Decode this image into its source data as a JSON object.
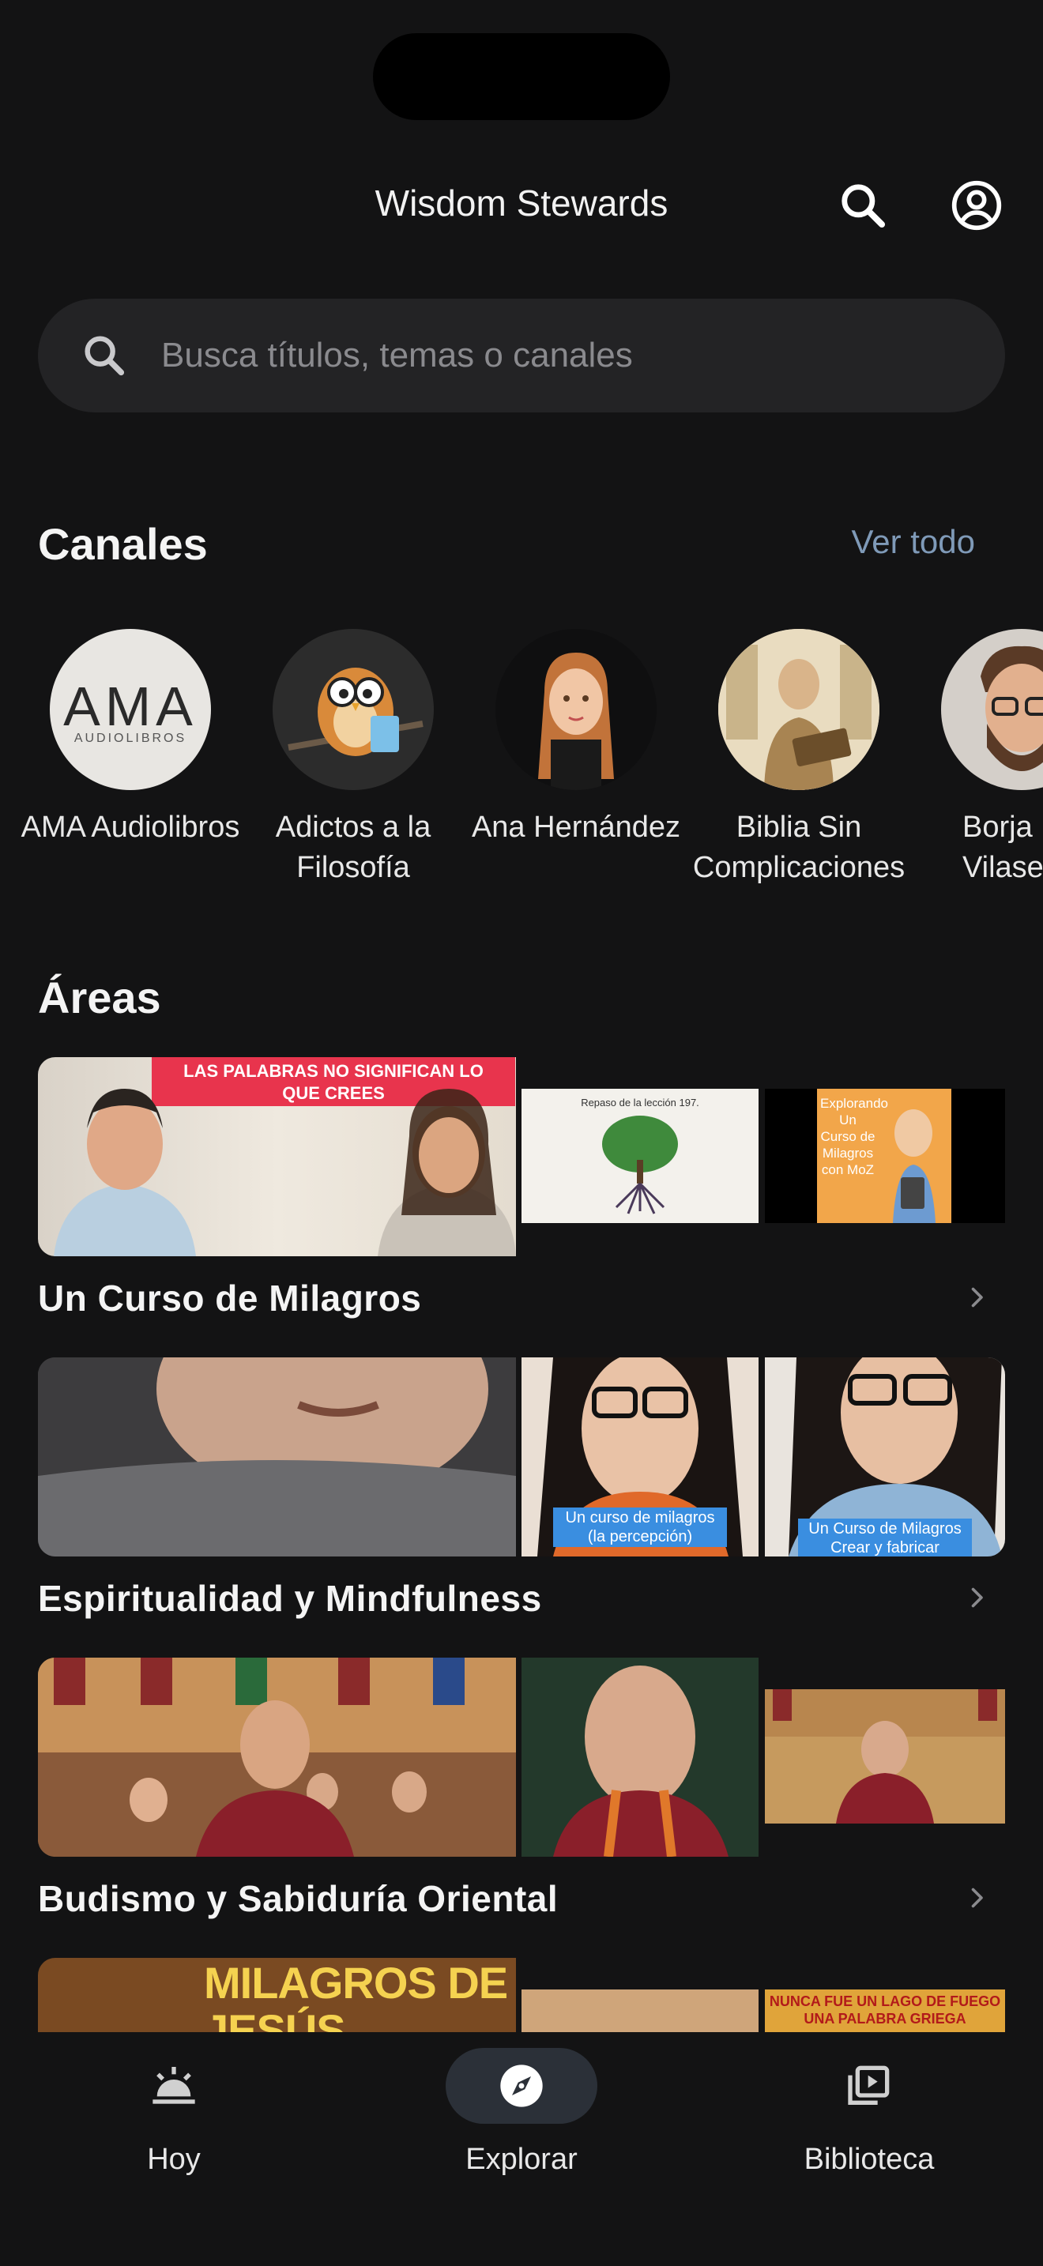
{
  "header": {
    "title": "Wisdom Stewards"
  },
  "search": {
    "placeholder": "Busca títulos, temas o canales"
  },
  "channels_section": {
    "title": "Canales",
    "see_all": "Ver todo",
    "items": [
      {
        "name": "AMA Audiolibros",
        "logo_main": "AMA",
        "logo_sub": "AUDIOLIBROS"
      },
      {
        "name": "Adictos a la Filosofía"
      },
      {
        "name": "Ana Hernández"
      },
      {
        "name": "Biblia Sin Complicaciones"
      },
      {
        "name": "Borja Vilaseca"
      }
    ]
  },
  "areas_section": {
    "title": "Áreas",
    "items": [
      {
        "label": "Un Curso de Milagros",
        "thumb1_banner": "LAS PALABRAS NO SIGNIFICAN LO QUE CREES",
        "thumb2_text": "Repaso de la lección 197.",
        "thumb3_text": "Explorando Un Curso de Milagros con MoZ"
      },
      {
        "label": "Espiritualidad y Mindfulness",
        "thumb2_caption": "Un curso de milagros (la percepción)",
        "thumb3_caption": "Un Curso de Milagros Crear y fabricar"
      },
      {
        "label": "Budismo y Sabiduría Oriental"
      },
      {
        "label": "",
        "thumb1_text": "MILAGROS DE JESÚS",
        "thumb3_text": "NUNCA FUE UN LAGO DE FUEGO UNA PALABRA GRIEGA"
      }
    ]
  },
  "bottom_nav": {
    "items": [
      {
        "label": "Hoy",
        "icon": "sunrise-icon",
        "active": false
      },
      {
        "label": "Explorar",
        "icon": "compass-icon",
        "active": true
      },
      {
        "label": "Biblioteca",
        "icon": "video-library-icon",
        "active": false
      }
    ]
  },
  "colors": {
    "background": "#131314",
    "search_bg": "#232325",
    "link": "#7f9ab8",
    "active_pill": "#2b3038"
  }
}
